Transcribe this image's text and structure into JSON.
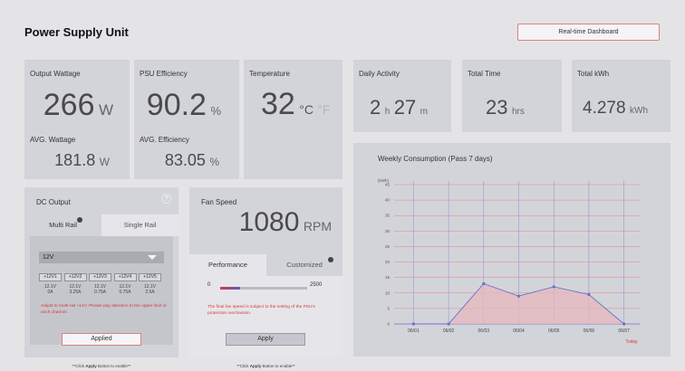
{
  "header": {
    "title": "Power Supply Unit",
    "dashboard_button": "Real-time Dashboard",
    "accent": "#d63a3a"
  },
  "stats": {
    "output_wattage": {
      "label": "Output Wattage",
      "value": "266",
      "unit": "W"
    },
    "avg_wattage": {
      "label": "AVG. Wattage",
      "value": "181.8",
      "unit": "W"
    },
    "psu_efficiency": {
      "label": "PSU Efficiency",
      "value": "90.2",
      "unit": "%"
    },
    "avg_efficiency": {
      "label": "AVG. Efficiency",
      "value": "83.05",
      "unit": "%"
    },
    "temperature": {
      "label": "Temperature",
      "value": "32",
      "unit_c": "°C",
      "unit_f": "°F"
    },
    "daily_activity": {
      "label": "Daily Activity",
      "hours": "2",
      "h_unit": "h",
      "minutes": "27",
      "m_unit": "m"
    },
    "total_time": {
      "label": "Total Time",
      "value": "23",
      "unit": "hrs"
    },
    "total_kwh": {
      "label": "Total kWh",
      "value": "4.278",
      "unit": "kWh"
    }
  },
  "dc_output": {
    "title": "DC Output",
    "help_icon": "?",
    "tabs": [
      "Multi Rail",
      "Single Rail"
    ],
    "rail_select": "12V",
    "rails": [
      {
        "name": "+12V1",
        "volt": "12.1V",
        "amp": "0A"
      },
      {
        "name": "+12V2",
        "volt": "12.1V",
        "amp": "3.25A"
      },
      {
        "name": "+12V3",
        "volt": "12.1V",
        "amp": "0.75A"
      },
      {
        "name": "+12V4",
        "volt": "12.1V",
        "amp": "0.75A"
      },
      {
        "name": "+12V5",
        "volt": "12.1V",
        "amp": "2.5A"
      }
    ],
    "warning": "Adjust to multi-rail +12V. Please pay attention to the upper limit of each channel.",
    "apply_button": "Applied",
    "footnote_pre": "**Click ",
    "footnote_bold": "Apply",
    "footnote_post": " Button to enable**"
  },
  "fan_speed": {
    "title": "Fan Speed",
    "value": "1080",
    "unit": "RPM",
    "tabs": [
      "Performance",
      "Customized"
    ],
    "slider_min": "0",
    "slider_max": "2500",
    "slider_level": 0.23,
    "warning": "The final fan speed is subject to the setting of the PSU's protection mechanism.",
    "apply_button": "Apply",
    "footnote_pre": "**Click ",
    "footnote_bold": "Apply",
    "footnote_post": " Button to enable**"
  },
  "chart_data": {
    "type": "area",
    "title": "Weekly Consumption (Pass 7 days)",
    "ylabel": "(kWh)",
    "ylim": [
      0,
      45
    ],
    "yticks": [
      0,
      5,
      10,
      15,
      20,
      25,
      30,
      35,
      40,
      45
    ],
    "categories": [
      "06/01",
      "06/02",
      "06/03",
      "06/04",
      "06/05",
      "06/06",
      "06/07"
    ],
    "values": [
      0,
      0,
      13,
      9,
      12,
      9.5,
      0
    ],
    "today_label": "Today",
    "line_color": "#6b6fc6",
    "fill_color": "#e5b8bd"
  }
}
